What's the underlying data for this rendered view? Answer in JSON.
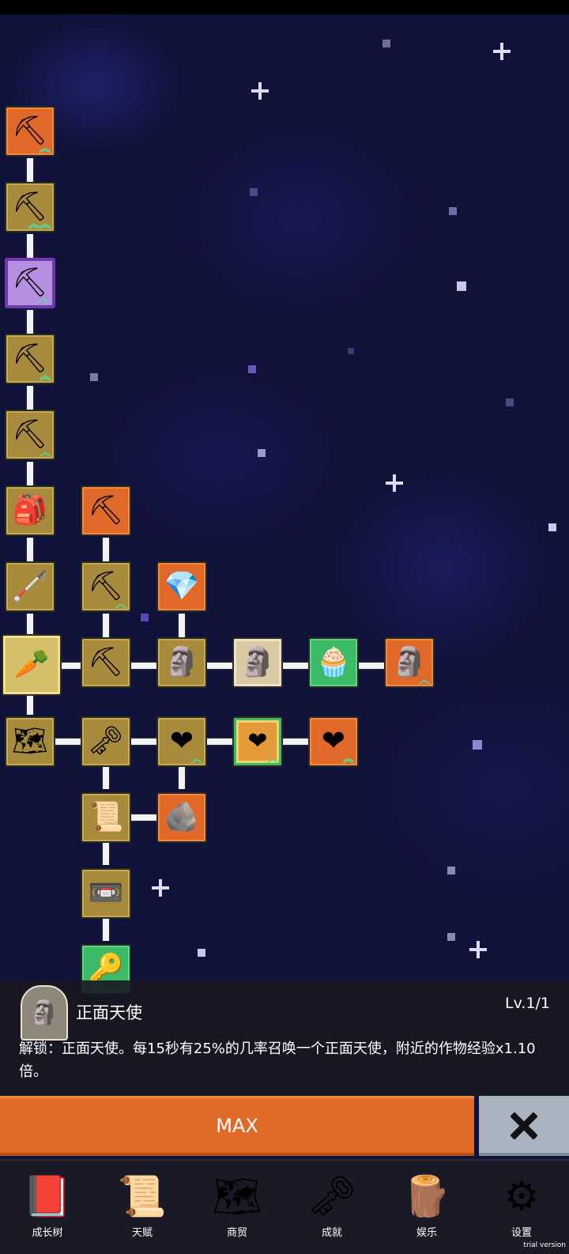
{
  "tree": {
    "nodes": [
      {
        "id": "n1",
        "glyph": "⛏",
        "name": "shovel-node",
        "color": "orange",
        "upgrade": "︽"
      },
      {
        "id": "n2",
        "glyph": "⛏",
        "name": "shovel-node",
        "color": "gold",
        "upgrade": "︽︽"
      },
      {
        "id": "n3",
        "glyph": "⛏",
        "name": "magic-shovel-node",
        "color": "purple",
        "upgrade": "︿"
      },
      {
        "id": "n4",
        "glyph": "⛏",
        "name": "shovel-node",
        "color": "gold",
        "upgrade": "︽"
      },
      {
        "id": "n5",
        "glyph": "⛏",
        "name": "shovel-node",
        "color": "gold",
        "upgrade": "︿"
      },
      {
        "id": "n6",
        "glyph": "🎒",
        "name": "backpack-node",
        "color": "gold",
        "upgrade": ""
      },
      {
        "id": "n7",
        "glyph": "🦯",
        "name": "stick-node",
        "color": "gold",
        "upgrade": ""
      },
      {
        "id": "n8",
        "glyph": "🥕",
        "name": "carrot-node",
        "color": "selected",
        "upgrade": ""
      },
      {
        "id": "n9",
        "glyph": "🗺",
        "name": "map-node",
        "color": "gold",
        "upgrade": ""
      },
      {
        "id": "n10",
        "glyph": "⛏",
        "name": "pickaxe-node",
        "color": "orange",
        "upgrade": ""
      },
      {
        "id": "n11",
        "glyph": "⛏",
        "name": "pickaxe-node",
        "color": "gold",
        "upgrade": "︿"
      },
      {
        "id": "n12",
        "glyph": "⛏",
        "name": "pickaxe-node",
        "color": "gold",
        "upgrade": ""
      },
      {
        "id": "n13",
        "glyph": "🗝",
        "name": "golden-key-node",
        "color": "gold",
        "upgrade": ""
      },
      {
        "id": "n14",
        "glyph": "📜",
        "name": "scroll-node",
        "color": "gold",
        "upgrade": ""
      },
      {
        "id": "n15",
        "glyph": "📼",
        "name": "tape-node",
        "color": "gold",
        "upgrade": ""
      },
      {
        "id": "n16",
        "glyph": "🔑",
        "name": "key-node",
        "color": "green",
        "upgrade": ""
      },
      {
        "id": "n17",
        "glyph": "💎",
        "name": "crystal-node",
        "color": "orange",
        "upgrade": ""
      },
      {
        "id": "n18",
        "glyph": "🗿",
        "name": "angel-statue-node",
        "color": "gold",
        "upgrade": ""
      },
      {
        "id": "n19",
        "glyph": "❤",
        "name": "heart-node",
        "color": "gold",
        "upgrade": "︿"
      },
      {
        "id": "n20",
        "glyph": "🪨",
        "name": "fossil-node",
        "color": "orange",
        "upgrade": ""
      },
      {
        "id": "n21",
        "glyph": "🗿",
        "name": "positive-angel-node",
        "color": "beige",
        "upgrade": ""
      },
      {
        "id": "n22",
        "glyph": "❤",
        "name": "heart-node",
        "color": "goldframe",
        "upgrade": "︿"
      },
      {
        "id": "n23",
        "glyph": "🧁",
        "name": "cupcake-node",
        "color": "green",
        "upgrade": ""
      },
      {
        "id": "n24",
        "glyph": "❤",
        "name": "heart-node",
        "color": "orange",
        "upgrade": "︽"
      },
      {
        "id": "n25",
        "glyph": "🗿",
        "name": "angel-statue-node",
        "color": "orange",
        "upgrade": "︿"
      }
    ]
  },
  "selected_skill": {
    "icon": "angel-statue-icon",
    "name": "正面天使",
    "level": "Lv.1/1",
    "description": "解锁：正面天使。每15秒有25%的几率召唤一个正面天使，附近的作物经验x1.10倍。"
  },
  "actions": {
    "max_label": "MAX",
    "close_icon": "close-icon"
  },
  "nav": {
    "items": [
      {
        "label": "成长树",
        "icon": "book-icon",
        "glyph": "📕"
      },
      {
        "label": "天赋",
        "icon": "scroll-icon",
        "glyph": "📜"
      },
      {
        "label": "商贸",
        "icon": "map-icon",
        "glyph": "🗺"
      },
      {
        "label": "成就",
        "icon": "key-icon",
        "glyph": "🗝"
      },
      {
        "label": "娱乐",
        "icon": "wood-icon",
        "glyph": "🪵"
      },
      {
        "label": "设置",
        "icon": "gear-icon",
        "glyph": "⚙"
      }
    ]
  },
  "watermark": "trial version",
  "colors": {
    "orange": "#e0692a",
    "gold": "#a78a3c",
    "green": "#3dba68",
    "purple": "#b690e0",
    "background": "#11123a"
  }
}
